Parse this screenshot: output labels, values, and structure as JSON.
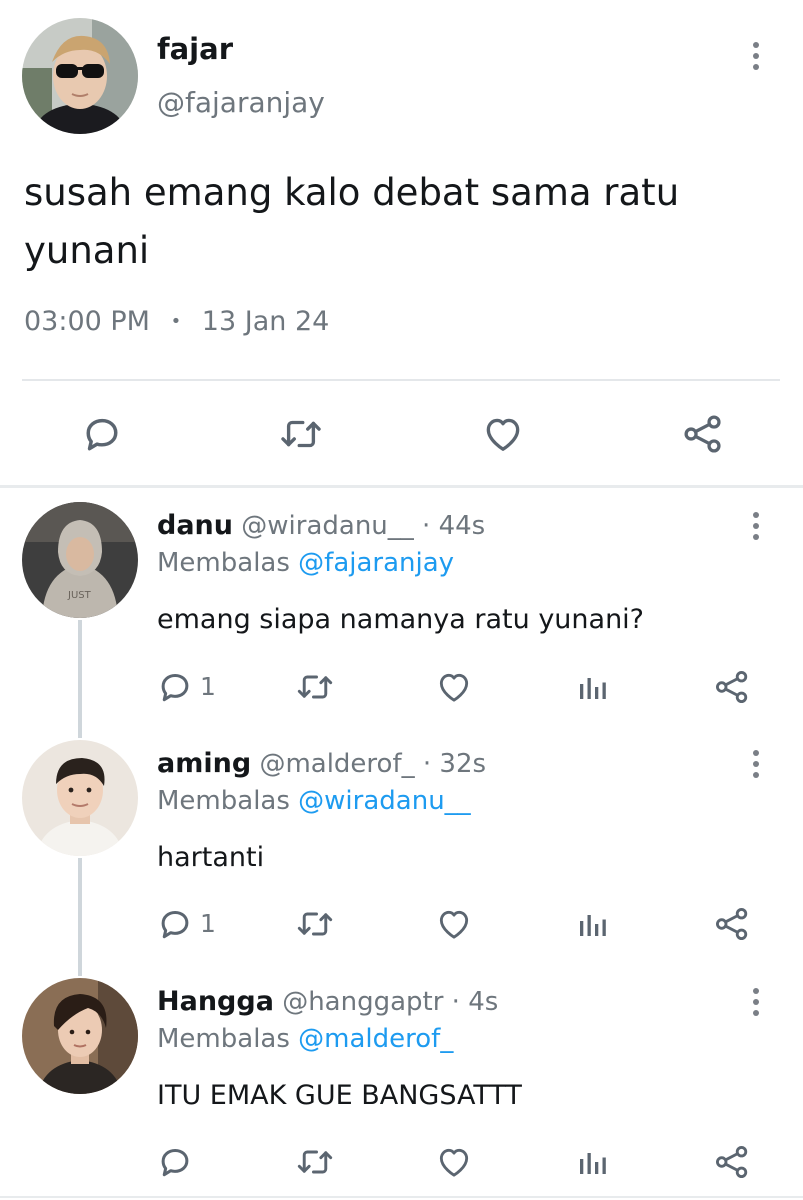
{
  "main_tweet": {
    "author": {
      "name": "fajar",
      "handle": "@fajaranjay"
    },
    "text": "susah emang kalo debat sama ratu yunani",
    "time": "03:00 PM",
    "separator": "•",
    "date": "13 Jan 24",
    "actions": {
      "reply_icon": "reply-icon",
      "retweet_icon": "retweet-icon",
      "like_icon": "heart-icon",
      "share_icon": "share-icon"
    }
  },
  "replies": [
    {
      "name": "danu",
      "handle": "@wiradanu__",
      "time": "· 44s",
      "replying_prefix": "Membalas",
      "replying_to": "@fajaranjay",
      "text": "emang siapa namanya ratu yunani?",
      "reply_count": "1"
    },
    {
      "name": "aming",
      "handle": "@malderof_",
      "time": "· 32s",
      "replying_prefix": "Membalas",
      "replying_to": "@wiradanu__",
      "text": "hartanti",
      "reply_count": "1"
    },
    {
      "name": "Hangga",
      "handle": "@hanggaptr",
      "time": "· 4s",
      "replying_prefix": "Membalas",
      "replying_to": "@malderof_",
      "text": "ITU EMAK GUE BANGSATTT",
      "reply_count": ""
    }
  ],
  "colors": {
    "accent": "#1d9bf0",
    "text": "#14171a",
    "secondary": "#6e767d",
    "icon": "#5b6570",
    "divider": "#dfe3e6"
  }
}
